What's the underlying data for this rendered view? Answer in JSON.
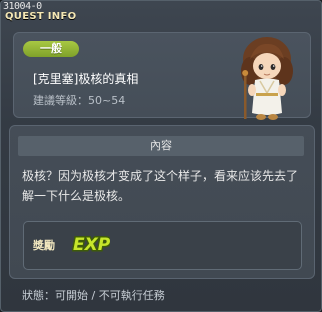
{
  "window": {
    "quest_id": "31004-0",
    "title": "QUEST INFO"
  },
  "header": {
    "type_badge": "一般",
    "quest_name": "[克里塞]极核的真相",
    "level_label": "建議等級：",
    "level_range": "50~54",
    "npc_icon": "npc-portrait"
  },
  "content": {
    "section_title": "內容",
    "description": "极核？因为极核才变成了这个样子，看来应该先去了解一下什么是极核。",
    "reward": {
      "label": "獎勵",
      "item_icon": "exp-icon",
      "item_text": "EXP"
    }
  },
  "status": {
    "text": "狀態：可開始 / 不可執行任務"
  },
  "colors": {
    "badge": "#8fb232",
    "title": "#f4e7b4",
    "exp": "#c6e62b"
  }
}
